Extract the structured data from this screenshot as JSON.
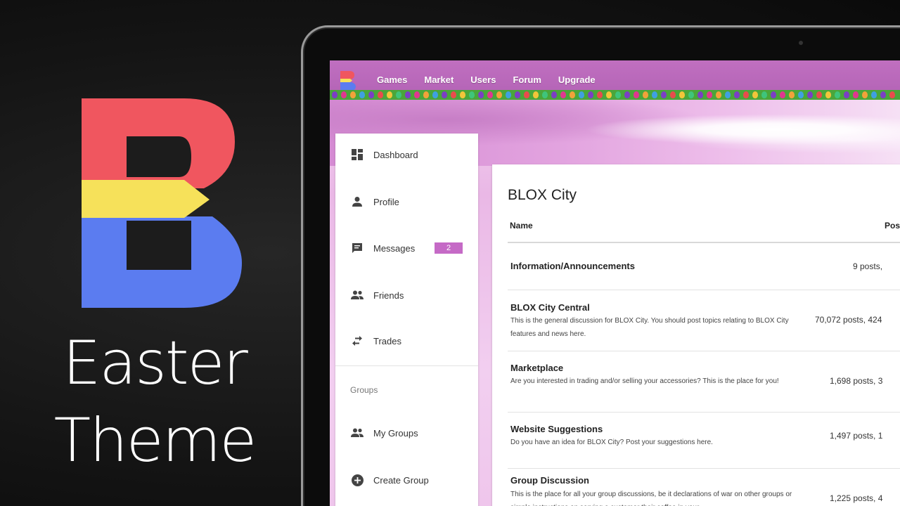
{
  "promo": {
    "title_line1": "Easter",
    "title_line2": "Theme",
    "colors": {
      "red": "#f0565f",
      "yellow": "#f6e15a",
      "blue": "#5b7cf0"
    }
  },
  "nav": {
    "links": [
      "Games",
      "Market",
      "Users",
      "Forum",
      "Upgrade"
    ],
    "color": "#b96abb"
  },
  "sidebar": {
    "items": [
      {
        "label": "Dashboard",
        "icon": "dashboard-icon"
      },
      {
        "label": "Profile",
        "icon": "person-icon"
      },
      {
        "label": "Messages",
        "icon": "chat-icon",
        "badge": "2"
      },
      {
        "label": "Friends",
        "icon": "people-icon"
      },
      {
        "label": "Trades",
        "icon": "swap-icon"
      }
    ],
    "section_label": "Groups",
    "group_items": [
      {
        "label": "My Groups",
        "icon": "people-icon"
      },
      {
        "label": "Create Group",
        "icon": "add-circle-icon"
      }
    ]
  },
  "forum": {
    "title": "BLOX City",
    "columns": {
      "name": "Name",
      "posts": "Pos"
    },
    "categories": [
      {
        "title": "Information/Announcements",
        "description": "",
        "stats": "9 posts,"
      },
      {
        "title": "BLOX City Central",
        "description": "This is the general discussion for BLOX City. You should post topics relating to BLOX City features and news here.",
        "stats": "70,072 posts, 424"
      },
      {
        "title": "Marketplace",
        "description": "Are you interested in trading and/or selling your accessories? This is the place for you!",
        "stats": "1,698 posts, 3"
      },
      {
        "title": "Website Suggestions",
        "description": "Do you have an idea for BLOX City? Post your suggestions here.",
        "stats": "1,497 posts, 1"
      },
      {
        "title": "Group Discussion",
        "description": "This is the place for all your group discussions, be it declarations of war on other groups or simple instructions on serving a customer their coffee in your",
        "stats": "1,225 posts, 4"
      }
    ]
  },
  "theme": {
    "accent": "#c56ac6",
    "grass": "#4aa63a"
  }
}
